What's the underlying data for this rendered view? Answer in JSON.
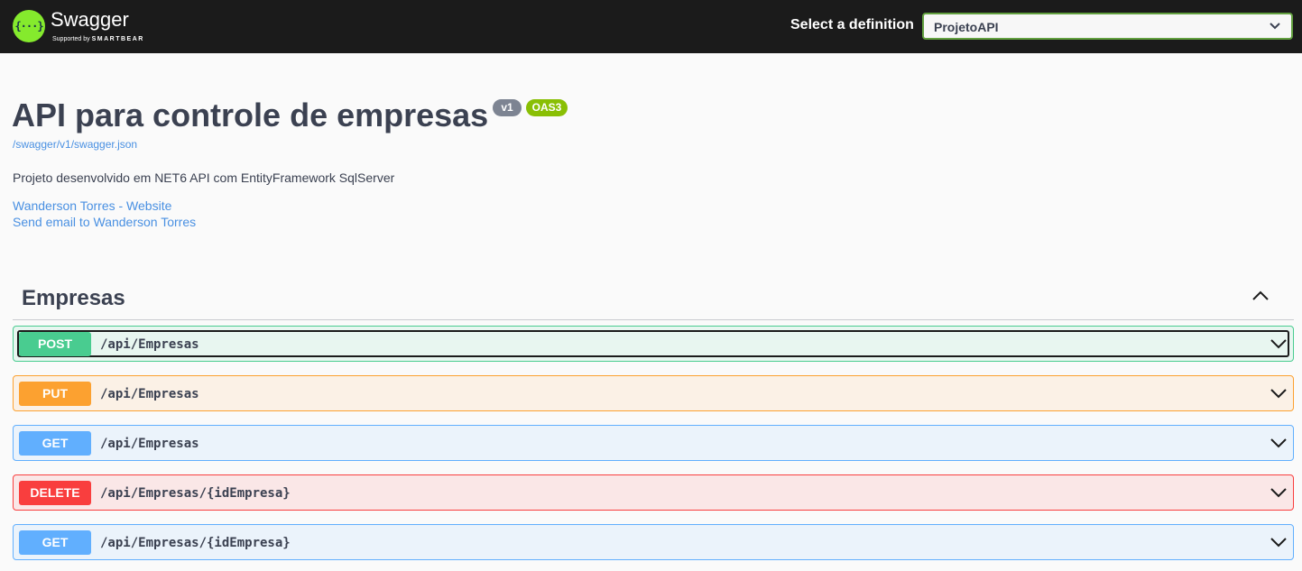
{
  "topbar": {
    "logo_symbol": "{···}",
    "brand": "Swagger",
    "supported_by": "Supported by",
    "supported_brand": "SMARTBEAR",
    "definition_label": "Select a definition",
    "definition_value": "ProjetoAPI"
  },
  "info": {
    "title": "API para controle de empresas",
    "version_badge": "v1",
    "oas_badge": "OAS3",
    "spec_url": "/swagger/v1/swagger.json",
    "description": "Projeto desenvolvido em NET6 API com EntityFramework SqlServer",
    "links": [
      {
        "label": "Wanderson Torres - Website"
      },
      {
        "label": "Send email to Wanderson Torres"
      }
    ]
  },
  "section": {
    "title": "Empresas",
    "toggle_icon": "chevron-up-icon"
  },
  "operations": [
    {
      "method": "POST",
      "path": "/api/Empresas",
      "color": "#49cc90",
      "bg": "#e8f6f0",
      "focused": true
    },
    {
      "method": "PUT",
      "path": "/api/Empresas",
      "color": "#fca130",
      "bg": "#fbf1e6"
    },
    {
      "method": "GET",
      "path": "/api/Empresas",
      "color": "#61affe",
      "bg": "#ebf3fb"
    },
    {
      "method": "DELETE",
      "path": "/api/Empresas/{idEmpresa}",
      "color": "#f93e3e",
      "bg": "#fae7e7"
    },
    {
      "method": "GET",
      "path": "/api/Empresas/{idEmpresa}",
      "color": "#61affe",
      "bg": "#ebf3fb"
    }
  ],
  "colors": {
    "topbar_bg": "#1b1b1b",
    "accent_green": "#85ea2d",
    "link": "#4990e2"
  }
}
